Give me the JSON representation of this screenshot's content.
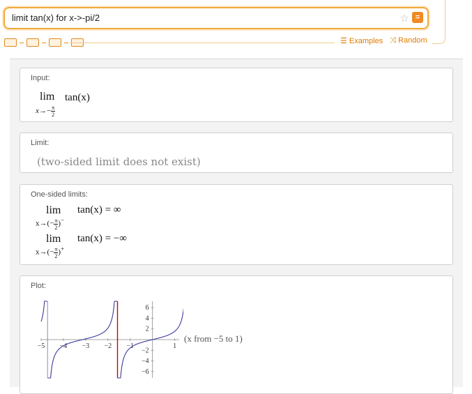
{
  "search": {
    "query": "limit tan(x) for x->-pi/2"
  },
  "links": {
    "examples": "Examples",
    "random": "Random"
  },
  "pods": {
    "input": {
      "title": "Input:",
      "lim": "lim",
      "sub_var": "x",
      "sub_arrow": "→−",
      "pi": "π",
      "two": "2",
      "expr": "tan(x)"
    },
    "limit": {
      "title": "Limit:",
      "value": "(two-sided limit does not exist)"
    },
    "one_sided": {
      "title": "One-sided limits:",
      "lim": "lim",
      "sub_prefix": "x→(−",
      "minus_sup": "−",
      "plus_sup": "+",
      "pi": "π",
      "two": "2",
      "close": ")",
      "expr_left": "tan(x) = ∞",
      "expr_right": "tan(x) = −∞"
    },
    "plot": {
      "title": "Plot:",
      "range_label": "(x from −5 to 1)"
    }
  },
  "chart_data": {
    "type": "line",
    "title": "",
    "xlabel": "",
    "ylabel": "",
    "xlim": [
      -5,
      1.2
    ],
    "ylim": [
      -7.2,
      7.2
    ],
    "x_ticks": [
      -5,
      -4,
      -3,
      -2,
      -1,
      1
    ],
    "y_ticks": [
      -6,
      -4,
      -2,
      2,
      4,
      6
    ],
    "function": "tan(x)",
    "highlight_x": -1.5708,
    "series_color": "#3a3a9e",
    "highlight_color": "#cc0000",
    "asymptote_color": "#6a6ab0",
    "grid": false
  }
}
